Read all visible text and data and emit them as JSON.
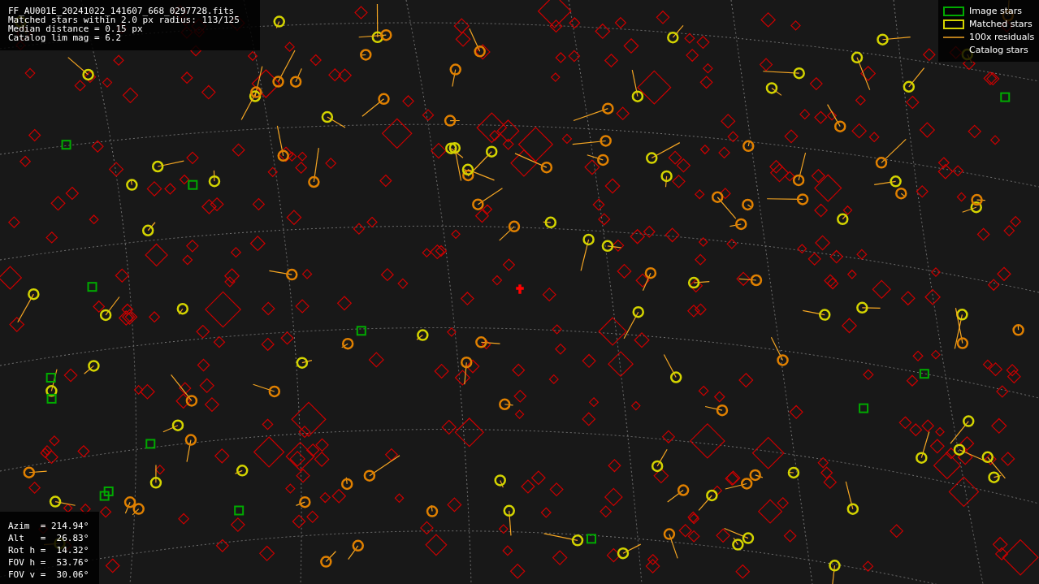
{
  "header": {
    "lines": [
      "FF_AU001E_20241022_141607_668_0297728.fits",
      "Matched stars within 2.0 px radius: 113/125",
      "Median distance = 0.15 px",
      "Catalog lim mag = 6.2"
    ]
  },
  "legend": [
    {
      "kind": "image",
      "label": "Image stars"
    },
    {
      "kind": "matched",
      "label": "Matched stars"
    },
    {
      "kind": "residual",
      "label": "100x residuals"
    },
    {
      "kind": "catalog",
      "label": "Catalog stars"
    }
  ],
  "pointing": {
    "lines": [
      "Azim  = 214.94°",
      "Alt   =  26.83°",
      "Rot h =  14.32°",
      "FOV h =  53.76°",
      "FOV v =  30.06°"
    ]
  }
}
